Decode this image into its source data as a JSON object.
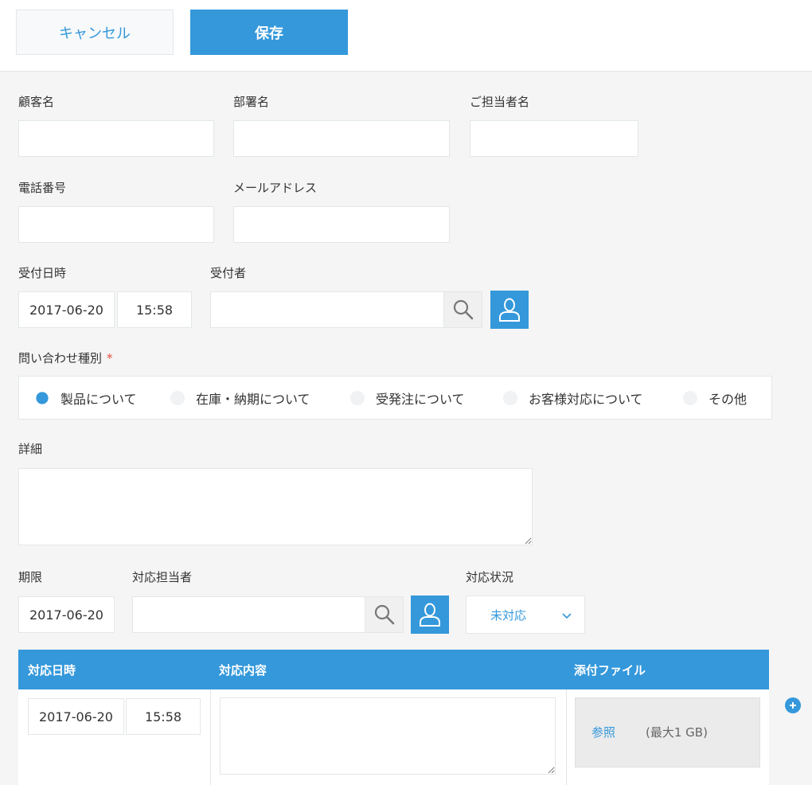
{
  "toolbar": {
    "cancel_label": "キャンセル",
    "save_label": "保存"
  },
  "fields": {
    "customer_name": {
      "label": "顧客名",
      "value": ""
    },
    "department": {
      "label": "部署名",
      "value": ""
    },
    "contact_person": {
      "label": "ご担当者名",
      "value": ""
    },
    "phone": {
      "label": "電話番号",
      "value": ""
    },
    "email": {
      "label": "メールアドレス",
      "value": ""
    },
    "received_at": {
      "label": "受付日時",
      "date": "2017-06-20",
      "time": "15:58"
    },
    "receiver": {
      "label": "受付者",
      "value": ""
    },
    "inquiry_type": {
      "label": "問い合わせ種別",
      "required_mark": "*",
      "options": [
        "製品について",
        "在庫・納期について",
        "受発注について",
        "お客様対応について",
        "その他"
      ],
      "selected": "製品について"
    },
    "details": {
      "label": "詳細",
      "value": ""
    },
    "deadline": {
      "label": "期限",
      "value": "2017-06-20"
    },
    "assignee": {
      "label": "対応担当者",
      "value": ""
    },
    "status": {
      "label": "対応状況",
      "value": "未対応"
    }
  },
  "table": {
    "headers": {
      "datetime": "対応日時",
      "content": "対応内容",
      "attachment": "添付ファイル"
    },
    "rows": [
      {
        "date": "2017-06-20",
        "time": "15:58",
        "content": "",
        "browse_label": "参照",
        "size_limit": "(最大1 GB)"
      }
    ]
  },
  "icons": {
    "search": "search-icon",
    "user": "user-icon",
    "chevron": "chevron-down-icon",
    "add": "plus-circle-icon"
  },
  "colors": {
    "accent": "#3498db",
    "required": "#e74c3c"
  }
}
